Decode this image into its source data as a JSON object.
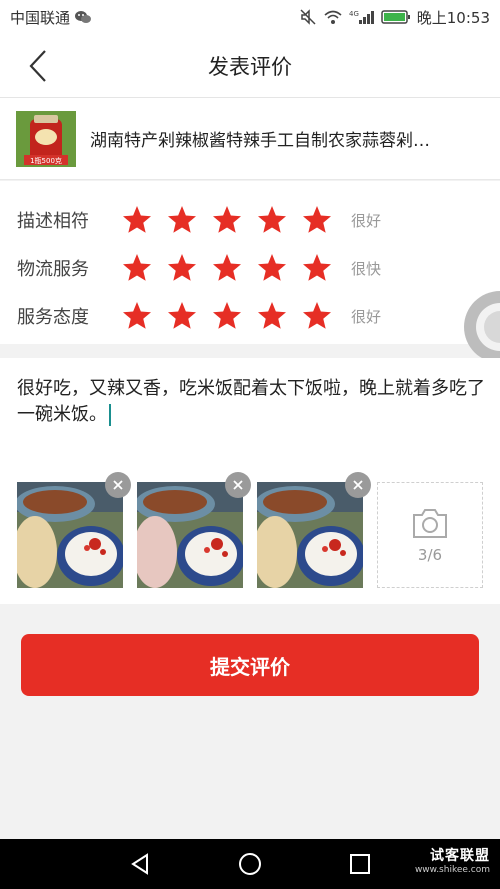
{
  "status_bar": {
    "carrier": "中国联通",
    "network": "4G",
    "time": "晚上10:53"
  },
  "header": {
    "title": "发表评价"
  },
  "product": {
    "name": "湖南特产剁辣椒酱特辣手工自制农家蒜蓉剁…",
    "thumb_text": "1瓶500克"
  },
  "ratings": [
    {
      "label": "描述相符",
      "stars": 5,
      "max": 5,
      "text": "很好"
    },
    {
      "label": "物流服务",
      "stars": 5,
      "max": 5,
      "text": "很快"
    },
    {
      "label": "服务态度",
      "stars": 5,
      "max": 5,
      "text": "很好"
    }
  ],
  "comment": {
    "text": "很好吃，又辣又香，吃米饭配着太下饭啦，晚上就着多吃了一碗米饭。"
  },
  "photos": {
    "count_label": "3/6",
    "items": [
      {
        "icon": "food-photo"
      },
      {
        "icon": "food-photo"
      },
      {
        "icon": "food-photo"
      }
    ]
  },
  "submit": {
    "label": "提交评价"
  },
  "watermark": {
    "main": "试客联盟",
    "sub": "www.shikee.com"
  },
  "colors": {
    "accent": "#e62e25",
    "star": "#e62e25"
  }
}
